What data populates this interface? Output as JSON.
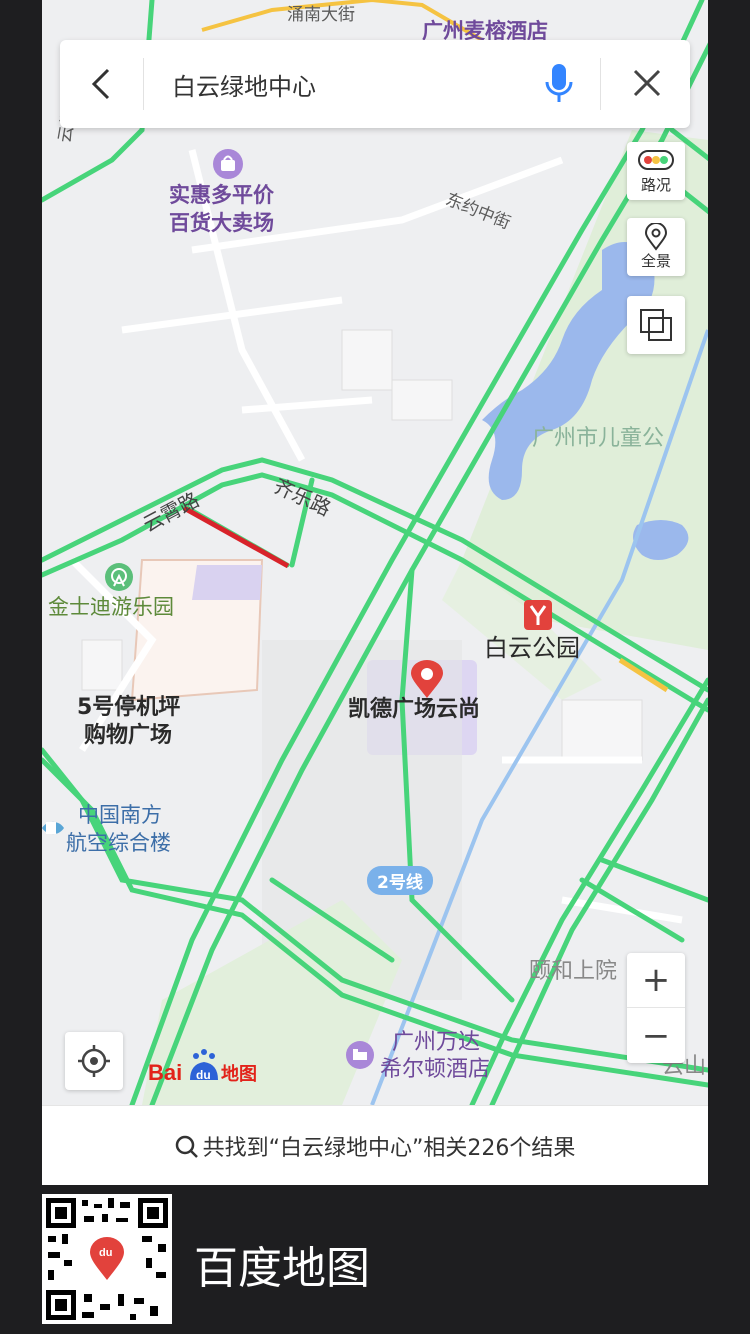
{
  "search": {
    "query": "白云绿地中心"
  },
  "map_controls": {
    "traffic_label": "路况",
    "panorama_label": "全景",
    "zoom_in": "+",
    "zoom_out": "−"
  },
  "map": {
    "labels": {
      "yongnan_street": "涌南大街",
      "hotel_top": "广州麦榕酒店",
      "street_left": "云街",
      "shop_line1": "实惠多平价",
      "shop_line2": "百货大卖场",
      "dongyue": "东约中街",
      "park": "广州市儿童公",
      "yunxiao": "云霄路",
      "qile": "齐乐路",
      "jinshidi": "金士迪游乐园",
      "baiyun_park": "白云公园",
      "kaide": "凯德广场云尚",
      "parking_line1": "5号停机坪",
      "parking_line2": "购物广场",
      "csa_line1": "中国南方",
      "csa_line2": "航空综合楼",
      "line2": "2号线",
      "yihe": "颐和上院",
      "wanda_line1": "广州万达",
      "wanda_line2": "希尔顿酒店",
      "yunshan": "云山"
    },
    "logo_text": "Bai地图"
  },
  "result": {
    "text": "共找到“白云绿地中心”相关226个结果"
  },
  "footer": {
    "brand": "百度地图"
  },
  "colors": {
    "road": "#47d47a",
    "congestion": "#d8232a",
    "slow": "#f5c342",
    "poi_purple": "#8e5bc4",
    "metro": "#e2423c"
  }
}
